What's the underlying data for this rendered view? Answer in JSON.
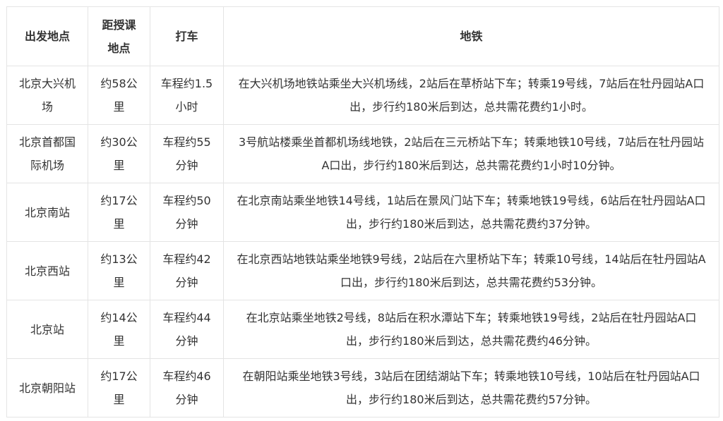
{
  "table": {
    "headers": [
      "出发地点",
      "距授课地点",
      "打车",
      "地铁"
    ],
    "rows": [
      {
        "origin": "北京大兴机场",
        "distance": "约58公里",
        "taxi": "车程约1.5小时",
        "subway": "在大兴机场地铁站乘坐大兴机场线，2站后在草桥站下车；转乘19号线，7站后在牡丹园站A口出，步行约180米后到达，总共需花费约1小时。"
      },
      {
        "origin": "北京首都国际机场",
        "distance": "约30公里",
        "taxi": "车程约55分钟",
        "subway": "3号航站楼乘坐首都机场线地铁，2站后在三元桥站下车；转乘地铁10号线，7站后在牡丹园站A口出，步行约180米后到达，总共需花费约1小时10分钟。"
      },
      {
        "origin": "北京南站",
        "distance": "约17公里",
        "taxi": "车程约50分钟",
        "subway": "在北京南站乘坐地铁14号线，1站后在景风门站下车；转乘地铁19号线，6站后在牡丹园站A口出，步行约180米后到达，总共需花费约37分钟。"
      },
      {
        "origin": "北京西站",
        "distance": "约13公里",
        "taxi": "车程约42分钟",
        "subway": "在北京西站地铁站乘坐地铁9号线，2站后在六里桥站下车；转乘10号线，14站后在牡丹园站A口出，步行约180米后到达，总共需花费约53分钟。"
      },
      {
        "origin": "北京站",
        "distance": "约14公里",
        "taxi": "车程约44分钟",
        "subway": "在北京站乘坐地铁2号线，8站后在积水潭站下车；转乘地铁19号线，2站后在牡丹园站A口出，步行约180米后到达，总共需花费约46分钟。"
      },
      {
        "origin": "北京朝阳站",
        "distance": "约17公里",
        "taxi": "车程约46分钟",
        "subway": "在朝阳站乘坐地铁3号线，3站后在团结湖站下车；转乘地铁10号线，10站后在牡丹园站A口出，步行约180米后到达，总共需花费约57分钟。"
      }
    ]
  }
}
